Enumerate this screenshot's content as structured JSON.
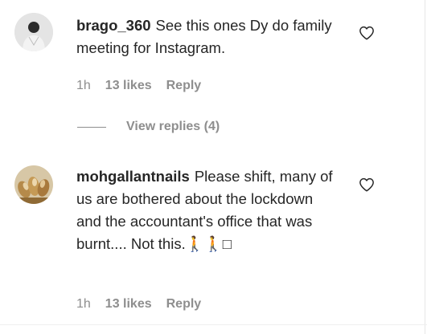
{
  "comments": [
    {
      "username": "brago_360",
      "text": "See this ones Dy do family meeting for Instagram.",
      "time": "1h",
      "likes": "13 likes",
      "reply_label": "Reply"
    },
    {
      "username": "mohgallantnails",
      "text": "Please shift, many of us are bothered about the lockdown and the accountant's office that was burnt.... Not this.🚶🚶□",
      "time": "1h",
      "likes": "13 likes",
      "reply_label": "Reply"
    }
  ],
  "view_replies": "View replies (4)",
  "colors": {
    "text": "#262626",
    "secondary": "#8e8e8e"
  },
  "icons": {
    "like": "heart-outline-icon"
  }
}
